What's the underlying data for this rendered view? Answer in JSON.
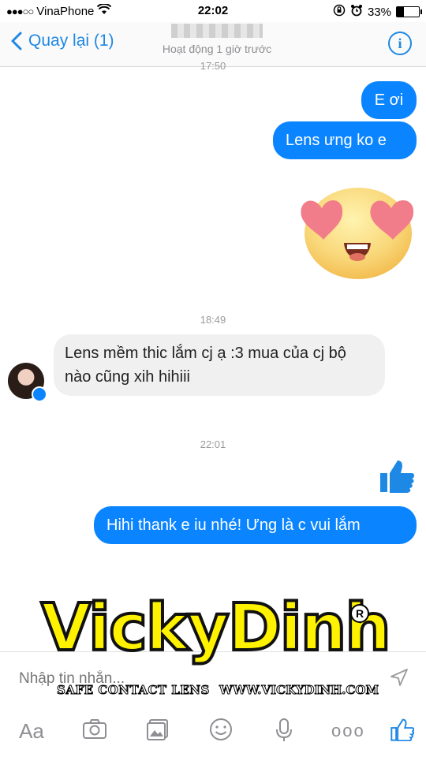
{
  "status": {
    "carrier": "VinaPhone",
    "signal": "●●●○○",
    "time": "22:02",
    "battery": "33%",
    "battery_level": 0.33
  },
  "nav": {
    "back_label": "Quay lại (1)",
    "subtitle": "Hoạt động 1 giờ trước"
  },
  "timestamps": {
    "top": "17:50",
    "mid": "18:49",
    "late": "22:01"
  },
  "messages": {
    "m1": "E ơi",
    "m2": "Lens ưng ko e",
    "m3": "Lens mềm thic lắm cj ạ :3 mua của cj bộ nào cũng xih hihiii",
    "m4": "Hihi thank e iu nhé! Ưng là c vui lắm"
  },
  "watermark": {
    "brand": "VickyDinh",
    "tagline": "SAFE CONTACT LENS",
    "url": "WWW.VICKYDINH.COM",
    "reg": "R"
  },
  "composer": {
    "placeholder": "Nhập tin nhắn..."
  },
  "toolbar": {
    "aa_label": "Aa",
    "more_label": "ooo"
  },
  "colors": {
    "accent": "#1e88e5",
    "outgoing_bubble": "#0a84ff",
    "incoming_bubble": "#f0f0f0"
  }
}
